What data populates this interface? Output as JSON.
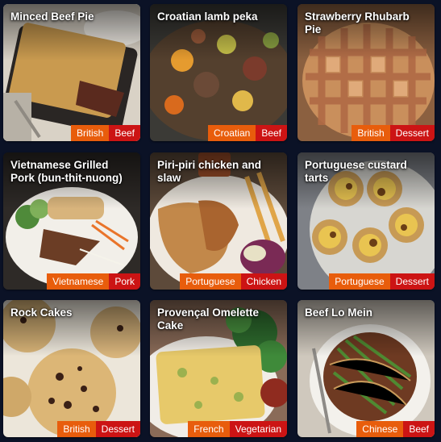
{
  "cards": [
    {
      "title": "Minced Beef Pie",
      "area": "British",
      "category": "Beef"
    },
    {
      "title": "Croatian lamb peka",
      "area": "Croatian",
      "category": "Beef"
    },
    {
      "title": "Strawberry Rhubarb Pie",
      "area": "British",
      "category": "Dessert"
    },
    {
      "title": "Vietnamese Grilled Pork (bun-thit-nuong)",
      "area": "Vietnamese",
      "category": "Pork"
    },
    {
      "title": "Piri-piri chicken and slaw",
      "area": "Portuguese",
      "category": "Chicken"
    },
    {
      "title": "Portuguese custard tarts",
      "area": "Portuguese",
      "category": "Dessert"
    },
    {
      "title": "Rock Cakes",
      "area": "British",
      "category": "Dessert"
    },
    {
      "title": "Provençal Omelette Cake",
      "area": "French",
      "category": "Vegetarian"
    },
    {
      "title": "Beef Lo Mein",
      "area": "Chinese",
      "category": "Beef"
    }
  ],
  "colors": {
    "background": "#0b1226",
    "area_tag": "#e85d0c",
    "category_tag": "#cc1414"
  }
}
